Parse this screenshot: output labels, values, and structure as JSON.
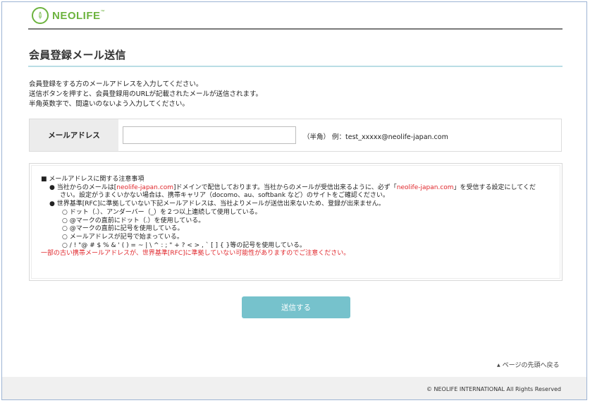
{
  "header": {
    "logo_text": "NEOLIFE",
    "logo_mark": "™",
    "brand_color": "#6cb33e"
  },
  "page": {
    "title": "会員登録メール送信"
  },
  "intro": {
    "lines": [
      "会員登録をする方のメールアドレスを入力してください。",
      "送信ボタンを押すと、会員登録用のURLが記載されたメールが送信されます。",
      "半角英数字で、間違いのないよう入力してください。"
    ]
  },
  "form": {
    "email_label": "メールアドレス",
    "email_value": "",
    "email_placeholder": "",
    "hint": "（半角） 例：test_xxxxx@neolife-japan.com"
  },
  "notice": {
    "heading": "■  メールアドレスに関する注意事項",
    "b1_prefix": "●  当社からのメールは[",
    "b1_domain": "neolife-japan.com",
    "b1_mid": "]ドメインで配信しております。当社からのメールが受信出来るように、必ず「",
    "b1_domain2": "neolife-japan.com",
    "b1_suffix": "」を受信する設定にしてくだ",
    "b1_cont": "さい。設定がうまくいかない場合は、携帯キャリア（docomo、au、softbank など）のサイトをご確認ください。",
    "b2": "●  世界基準[RFC]に準拠していない下記メールアドレスは、当社よりメールが送信出来ないため、登録が出来ません。",
    "subitems": [
      "○  ドット（.）、アンダーバー（_）を２つ以上連続して使用している。",
      "○  @マークの直前にドット（.）を使用している。",
      "○  @マークの直前に記号を使用している。",
      "○  メールアドレスが記号で始まっている。",
      "○  / ! \"@ # $ % & ' ( ) = ~ | \\ ^ : ; \" + ? < > , ` [ ] { }等の記号を使用している。"
    ],
    "warning": "一部の古い携帯メールアドレスが、世界基準[RFC]に準拠していない可能性がありますのでご注意ください。",
    "warning_color": "#e0262b"
  },
  "submit": {
    "label": "送信する",
    "color": "#76c2cc"
  },
  "nav": {
    "page_top": "ページの先頭へ戻る",
    "page_top_icon": "triangle-up-icon"
  },
  "footer": {
    "copyright": "© NEOLIFE INTERNATIONAL All Rights Reserved"
  }
}
